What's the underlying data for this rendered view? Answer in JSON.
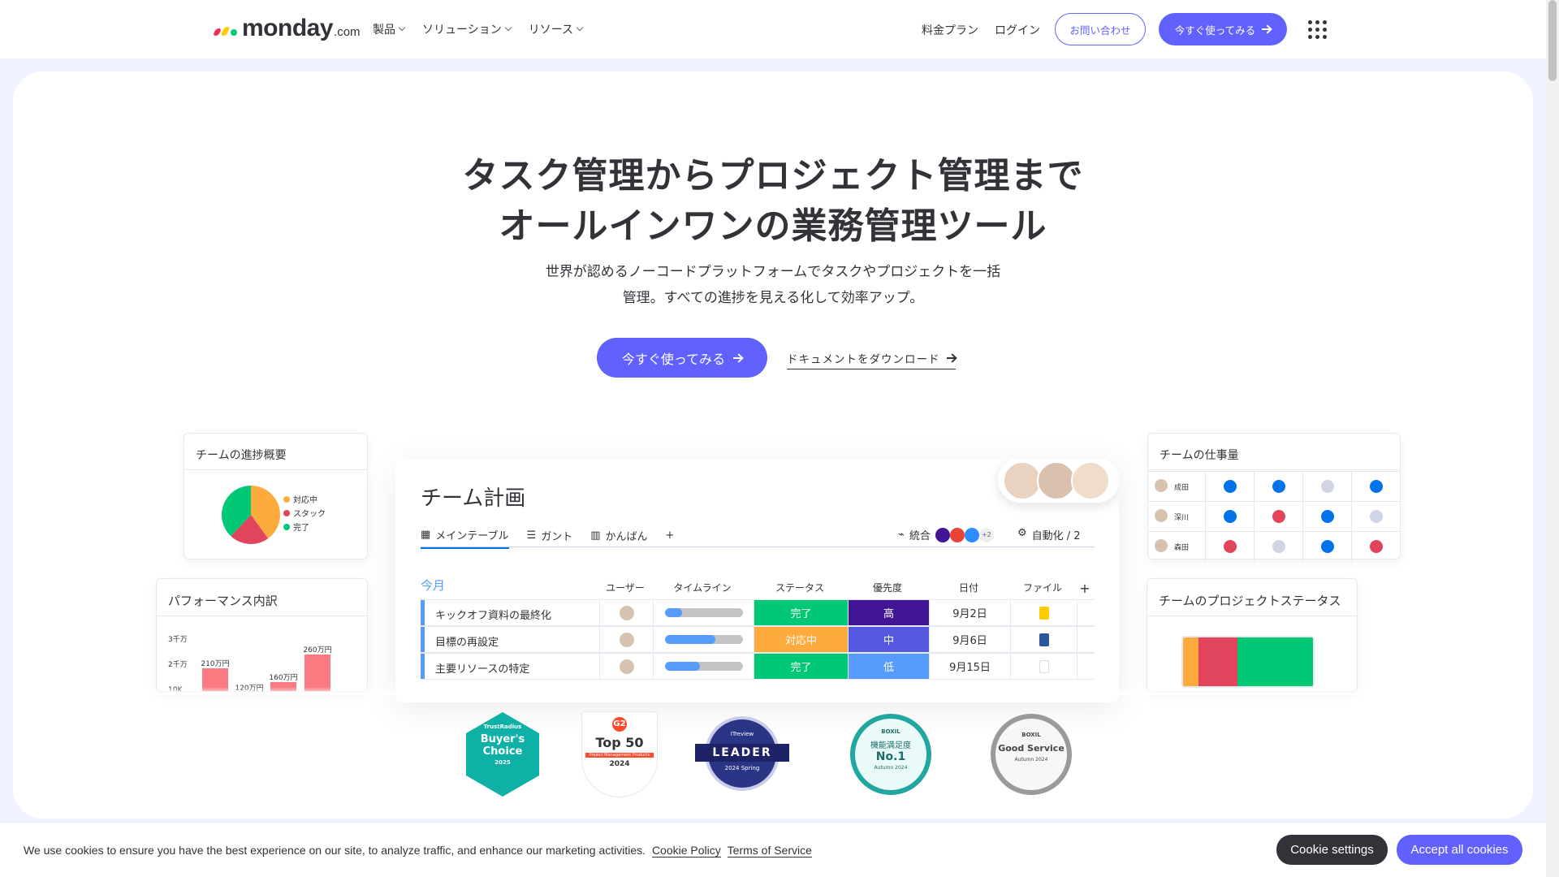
{
  "nav": {
    "logo_word": "monday",
    "logo_suffix": ".com",
    "menu": [
      {
        "label": "製品"
      },
      {
        "label": "ソリューション"
      },
      {
        "label": "リソース"
      }
    ],
    "pricing": "料金プラン",
    "login": "ログイン",
    "contact": "お問い合わせ",
    "cta": "今すぐ使ってみる"
  },
  "hero": {
    "title_line1": "タスク管理からプロジェクト管理まで",
    "title_line2": "オールインワンの業務管理ツール",
    "subtitle_line1": "世界が認めるノーコードプラットフォームでタスクやプロジェクトを一括",
    "subtitle_line2": "管理。すべての進捗を見える化して効率アップ。",
    "cta": "今すぐ使ってみる",
    "download": "ドキュメントをダウンロード"
  },
  "progress_widget": {
    "title": "チームの進捗概要",
    "legend": [
      {
        "label": "対応中",
        "color": "#fdab3d",
        "value": 0.4
      },
      {
        "label": "スタック",
        "color": "#e2445c",
        "value": 0.22
      },
      {
        "label": "完了",
        "color": "#00c875",
        "value": 0.38
      }
    ]
  },
  "performance_widget": {
    "title": "パフォーマンス内訳",
    "chart_data": {
      "type": "bar",
      "yticks": [
        "3千万",
        "2千万",
        "10K"
      ],
      "bars": [
        {
          "label": "210万円",
          "value": 210
        },
        {
          "label": "120万円",
          "value": 120
        },
        {
          "label": "160万円",
          "value": 160
        },
        {
          "label": "260万円",
          "value": 260
        }
      ]
    }
  },
  "board": {
    "title": "チーム計画",
    "tabs": [
      {
        "label": "メインテーブル"
      },
      {
        "label": "ガント"
      },
      {
        "label": "かんばん"
      }
    ],
    "add_tab": "+",
    "integrations": "統合",
    "integrations_more": "+2",
    "automation": "自動化 / 2",
    "group": "今月",
    "columns": [
      "ユーザー",
      "タイムライン",
      "ステータス",
      "優先度",
      "日付",
      "ファイル"
    ],
    "add_col": "+",
    "rows": [
      {
        "name": "キックオフ資料の最終化",
        "timeline": 0.22,
        "status": "完了",
        "status_color": "#00c875",
        "priority": "高",
        "priority_color": "#401694",
        "date": "9月2日"
      },
      {
        "name": "目標の再設定",
        "timeline": 0.65,
        "status": "対応中",
        "status_color": "#fdab3d",
        "priority": "中",
        "priority_color": "#5559df",
        "date": "9月6日"
      },
      {
        "name": "主要リソースの特定",
        "timeline": 0.45,
        "status": "完了",
        "status_color": "#00c875",
        "priority": "低",
        "priority_color": "#579bfc",
        "date": "9月15日"
      }
    ]
  },
  "workload_widget": {
    "title": "チームの仕事量",
    "people": [
      {
        "name": "成田",
        "dots": [
          "#0073ea",
          "#0073ea",
          "#d0d4e4",
          "#0073ea"
        ]
      },
      {
        "name": "深川",
        "dots": [
          "#0073ea",
          "#e2445c",
          "#0073ea",
          "#d0d4e4"
        ]
      },
      {
        "name": "森田",
        "dots": [
          "#e2445c",
          "#d0d4e4",
          "#0073ea",
          "#e2445c"
        ]
      }
    ]
  },
  "status_widget": {
    "title": "チームのプロジェクトステータス",
    "segments": [
      {
        "color": "#fdab3d",
        "value": 0.12
      },
      {
        "color": "#e2445c",
        "value": 0.3
      },
      {
        "color": "#00c875",
        "value": 0.58
      }
    ]
  },
  "badges": [
    {
      "name": "trustradius",
      "line1": "Buyer's",
      "line2": "Choice",
      "line3": "2025",
      "top": "TrustRadius"
    },
    {
      "name": "g2",
      "line1": "Top 50",
      "line2": "Project Management Products",
      "line3": "2024",
      "top": "G2"
    },
    {
      "name": "itreview",
      "line1": "LEADER",
      "line2": "2024 Spring",
      "top": "ITreview"
    },
    {
      "name": "boxil-satisfaction",
      "line1": "機能満足度",
      "line2": "No.1",
      "line3": "Autumn 2024",
      "top": "BOXIL"
    },
    {
      "name": "boxil-good",
      "line1": "Good Service",
      "line2": "Autumn 2024",
      "top": "BOXIL"
    }
  ],
  "cookie": {
    "text": "We use cookies to ensure you have the best experience on our site, to analyze traffic, and enhance our marketing activities.",
    "policy": "Cookie Policy",
    "terms": "Terms of Service",
    "settings": "Cookie settings",
    "accept": "Accept all cookies"
  }
}
